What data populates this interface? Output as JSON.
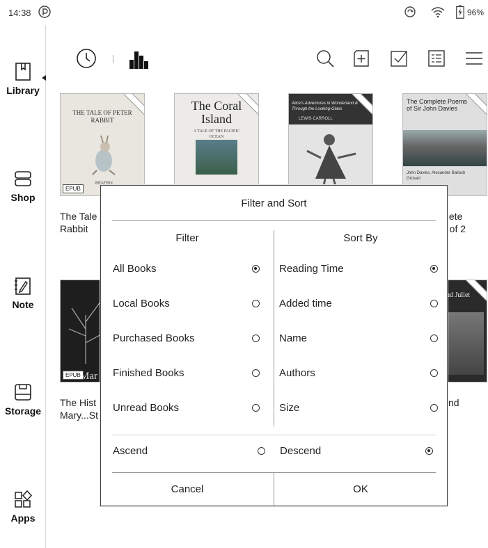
{
  "status": {
    "time": "14:38",
    "battery": "96%",
    "battery_level": 0.96
  },
  "sidebar": {
    "items": [
      {
        "label": "Library",
        "icon": "library-icon"
      },
      {
        "label": "Shop",
        "icon": "shop-icon"
      },
      {
        "label": "Note",
        "icon": "note-icon"
      },
      {
        "label": "Storage",
        "icon": "storage-icon"
      },
      {
        "label": "Apps",
        "icon": "apps-icon"
      }
    ]
  },
  "toolbar": {
    "icons": [
      "clock-icon",
      "bar-chart-icon",
      "search-icon",
      "add-icon",
      "select-icon",
      "list-view-icon",
      "menu-icon"
    ]
  },
  "books": [
    {
      "cover_title": "THE TALE OF PETER RABBIT",
      "cover_author": "BEATRIX",
      "title_line1": "The Tale",
      "title_line2": "Rabbit",
      "badge": "EPUB"
    },
    {
      "cover_title": "The Coral Island",
      "cover_sub": "A TALE OF THE PACIFIC OCEAN",
      "title_line1": "",
      "title_line2": ""
    },
    {
      "cover_title": "Alice's Adventures in Wonderland & Through the Looking-Glass",
      "cover_author": "LEWIS CARROLL"
    },
    {
      "cover_title": "The Complete Poems of Sir John Davies",
      "cover_author": "John Davies, Alexander Balloch Grosart",
      "title_line1": "plete",
      "title_line2": "2 of 2"
    },
    {
      "cover_title": "Mar",
      "title_line1": "The Hist",
      "title_line2": "Mary...St",
      "badge": "EPUB"
    },
    {
      "cover_title": "nd Juliet",
      "title_line1": "nd",
      "title_line2": ""
    }
  ],
  "dialog": {
    "title": "Filter and Sort",
    "filter_header": "Filter",
    "sort_header": "Sort By",
    "filter_options": [
      {
        "label": "All Books",
        "selected": true
      },
      {
        "label": "Local Books",
        "selected": false
      },
      {
        "label": "Purchased Books",
        "selected": false
      },
      {
        "label": "Finished Books",
        "selected": false
      },
      {
        "label": "Unread Books",
        "selected": false
      }
    ],
    "sort_options": [
      {
        "label": "Reading Time",
        "selected": true
      },
      {
        "label": "Added time",
        "selected": false
      },
      {
        "label": "Name",
        "selected": false
      },
      {
        "label": "Authors",
        "selected": false
      },
      {
        "label": "Size",
        "selected": false
      }
    ],
    "order": [
      {
        "label": "Ascend",
        "selected": false
      },
      {
        "label": "Descend",
        "selected": true
      }
    ],
    "cancel_label": "Cancel",
    "ok_label": "OK"
  }
}
